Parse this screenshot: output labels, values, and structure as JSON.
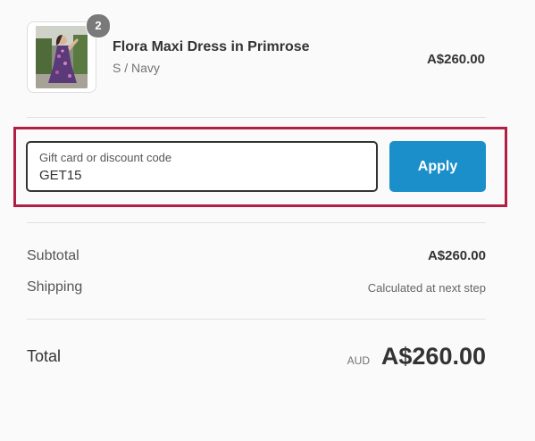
{
  "product": {
    "name": "Flora Maxi Dress in Primrose",
    "variant": "S / Navy",
    "price": "A$260.00",
    "quantity": "2",
    "image_icon": "product-photo-dress"
  },
  "discount": {
    "label": "Gift card or discount code",
    "value": "GET15",
    "apply_label": "Apply",
    "highlight_color": "#b11f45",
    "button_color": "#1b8fca"
  },
  "totals": {
    "subtotal_label": "Subtotal",
    "subtotal_value": "A$260.00",
    "shipping_label": "Shipping",
    "shipping_value": "Calculated at next step",
    "total_label": "Total",
    "currency": "AUD",
    "total_value": "A$260.00"
  }
}
